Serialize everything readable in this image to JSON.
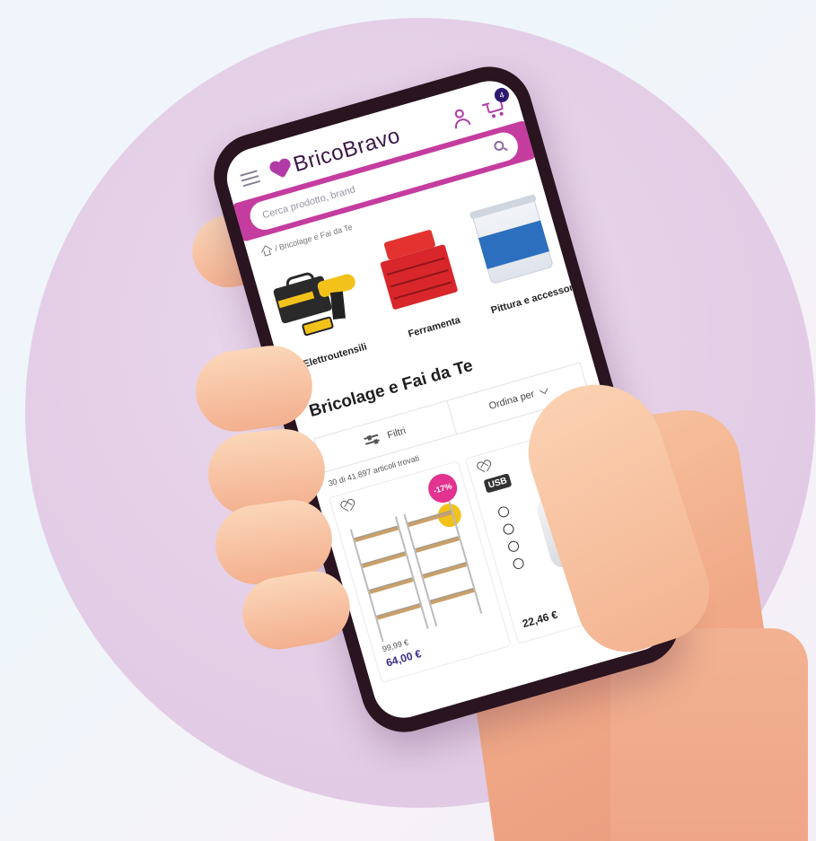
{
  "app": {
    "brand": "BricoBravo",
    "cart_count": "4",
    "brand_color": "#b13aa6",
    "accent_color": "#c53c9f"
  },
  "search": {
    "placeholder": "Cerca prodotto, brand"
  },
  "breadcrumb": {
    "label": "/ Bricolage e Fai da Te"
  },
  "categories": [
    {
      "label": "Elettroutensili",
      "icon": "power-tools"
    },
    {
      "label": "Ferramenta",
      "icon": "toolbox"
    },
    {
      "label": "Pittura e accessori",
      "icon": "paint-bucket"
    }
  ],
  "page": {
    "title": "Bricolage e Fai da Te",
    "filter_label": "Filtri",
    "sort_label": "Ordina per",
    "results_text": "30 di 41.897 articoli trovati"
  },
  "products": [
    {
      "badge": "-17%",
      "old_price": "99,99 €",
      "price": "64,00 €",
      "image": "metal-shelving"
    },
    {
      "badge": "USB",
      "price": "22,46 €",
      "image": "mosquito-lamp"
    }
  ]
}
